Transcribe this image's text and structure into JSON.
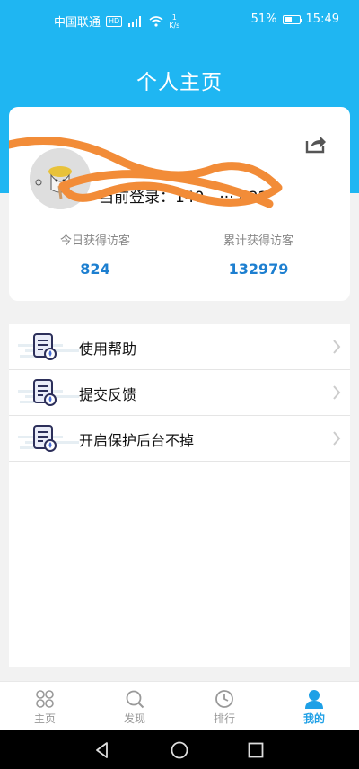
{
  "status_bar": {
    "carrier": "中国联通",
    "hd": "HD",
    "net_speed_value": "1",
    "net_speed_unit": "K/s",
    "battery": "51%",
    "battery_level": 0.51,
    "time": "15:49"
  },
  "header": {
    "title": "个人主页"
  },
  "profile": {
    "login_text": "当前登录：140  -  ··· 422",
    "stats": [
      {
        "label": "今日获得访客",
        "value": "824"
      },
      {
        "label": "累计获得访客",
        "value": "132979"
      }
    ]
  },
  "menu": {
    "items": [
      {
        "label": "使用帮助",
        "icon": "document-icon"
      },
      {
        "label": "提交反馈",
        "icon": "document-icon"
      },
      {
        "label": "开启保护后台不掉",
        "icon": "document-icon"
      }
    ]
  },
  "tabs": [
    {
      "label": "主页",
      "icon": "grid-icon",
      "active": false
    },
    {
      "label": "发现",
      "icon": "search-icon",
      "active": false
    },
    {
      "label": "排行",
      "icon": "clock-icon",
      "active": false
    },
    {
      "label": "我的",
      "icon": "user-icon",
      "active": true
    }
  ],
  "colors": {
    "header_blue": "#1fb6f2",
    "stat_value": "#1d7fd0",
    "tab_active": "#1fa0e6",
    "scribble": "#f28c38"
  }
}
